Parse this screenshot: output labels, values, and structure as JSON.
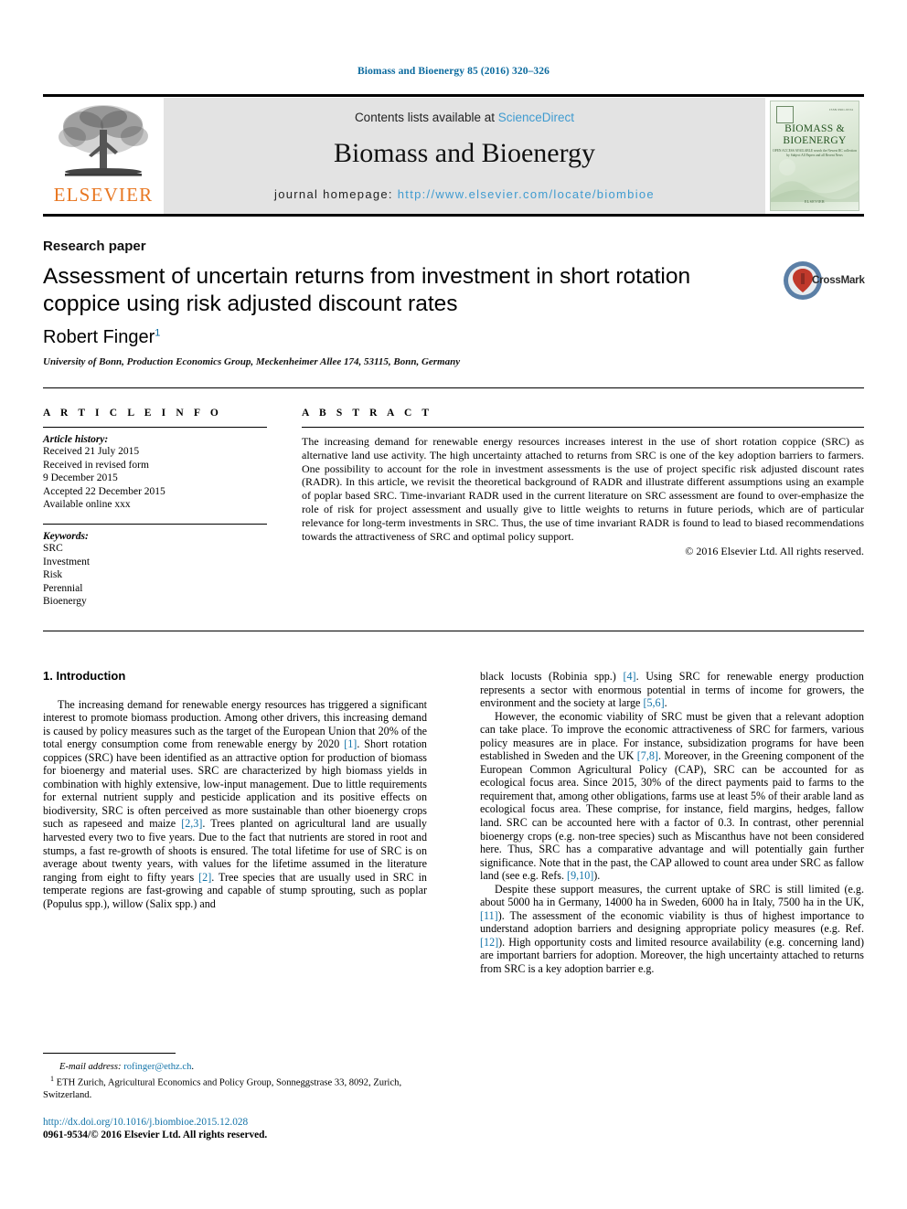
{
  "running_head": "Biomass and Bioenergy 85 (2016) 320–326",
  "masthead": {
    "publisher_name": "ELSEVIER",
    "contents_prefix": "Contents lists available at ",
    "contents_link": "ScienceDirect",
    "journal_name": "Biomass and Bioenergy",
    "homepage_prefix": "journal homepage: ",
    "homepage_url": "http://www.elsevier.com/locate/biombioe",
    "cover": {
      "title_line1": "BIOMASS &",
      "title_line2": "BIOENERGY",
      "subtitle": "OPEN ACCESS AVAILABLE\nsearch the Newest RC collection by Subject\nAll Papers and all Recent News",
      "issn": "ISSN 0961-9534",
      "footer": "ELSEVIER"
    }
  },
  "article": {
    "type": "Research paper",
    "title": "Assessment of uncertain returns from investment in short rotation coppice using risk adjusted discount rates",
    "crossmark_label": "CrossMark",
    "author": "Robert Finger",
    "author_footnote_marker": "1",
    "affiliation": "University of Bonn, Production Economics Group, Meckenheimer Allee 174, 53115, Bonn, Germany"
  },
  "article_info": {
    "heading": "A R T I C L E   I N F O",
    "history_label": "Article history:",
    "history": [
      "Received 21 July 2015",
      "Received in revised form",
      "9 December 2015",
      "Accepted 22 December 2015",
      "Available online xxx"
    ],
    "keywords_label": "Keywords:",
    "keywords": [
      "SRC",
      "Investment",
      "Risk",
      "Perennial",
      "Bioenergy"
    ]
  },
  "abstract": {
    "heading": "A B S T R A C T",
    "text": "The increasing demand for renewable energy resources increases interest in the use of short rotation coppice (SRC) as alternative land use activity. The high uncertainty attached to returns from SRC is one of the key adoption barriers to farmers. One possibility to account for the role in investment assessments is the use of project specific risk adjusted discount rates (RADR). In this article, we revisit the theoretical background of RADR and illustrate different assumptions using an example of poplar based SRC. Time-invariant RADR used in the current literature on SRC assessment are found to over-emphasize the role of risk for project assessment and usually give to little weights to returns in future periods, which are of particular relevance for long-term investments in SRC. Thus, the use of time invariant RADR is found to lead to biased recommendations towards the attractiveness of SRC and optimal policy support.",
    "copyright": "© 2016 Elsevier Ltd. All rights reserved."
  },
  "body": {
    "section_heading": "1. Introduction",
    "left_column": [
      {
        "parts": [
          {
            "t": "The increasing demand for renewable energy resources has triggered a significant interest to promote biomass production. Among other drivers, this increasing demand is caused by policy measures such as the target of the European Union that 20% of the total energy consumption come from renewable energy by 2020 "
          },
          {
            "t": "[1]",
            "ref": true
          },
          {
            "t": ". Short rotation coppices (SRC) have been identified as an attractive option for production of biomass for bioenergy and material uses. SRC are characterized by high biomass yields in combination with highly extensive, low-input management. Due to little requirements for external nutrient supply and pesticide application and its positive effects on biodiversity, SRC is often perceived as more sustainable than other bioenergy crops such as rapeseed and maize "
          },
          {
            "t": "[2,3]",
            "ref": true
          },
          {
            "t": ". Trees planted on agricultural land are usually harvested every two to five years. Due to the fact that nutrients are stored in root and stumps, a fast re-growth of shoots is ensured. The total lifetime for use of SRC is on average about twenty years, with values for the lifetime assumed in the literature ranging from eight to fifty years "
          },
          {
            "t": "[2]",
            "ref": true
          },
          {
            "t": ". Tree species that are usually used in SRC in temperate regions are fast-growing and capable of stump sprouting, such as poplar (Populus spp.), willow (Salix spp.) and"
          }
        ]
      }
    ],
    "right_column": [
      {
        "indent": false,
        "parts": [
          {
            "t": "black locusts (Robinia spp.) "
          },
          {
            "t": "[4]",
            "ref": true
          },
          {
            "t": ". Using SRC for renewable energy production represents a sector with enormous potential in terms of income for growers, the environment and the society at large "
          },
          {
            "t": "[5,6]",
            "ref": true
          },
          {
            "t": "."
          }
        ]
      },
      {
        "indent": true,
        "parts": [
          {
            "t": "However, the economic viability of SRC must be given that a relevant adoption can take place. To improve the economic attractiveness of SRC for farmers, various policy measures are in place. For instance, subsidization programs for have been established in Sweden and the UK "
          },
          {
            "t": "[7,8]",
            "ref": true
          },
          {
            "t": ". Moreover, in the Greening component of the European Common Agricultural Policy (CAP), SRC can be accounted for as ecological focus area. Since 2015, 30% of the direct payments paid to farms to the requirement that, among other obligations, farms use at least 5% of their arable land as ecological focus area. These comprise, for instance, field margins, hedges, fallow land. SRC can be accounted here with a factor of 0.3. In contrast, other perennial bioenergy crops (e.g. non-tree species) such as Miscanthus have not been considered here. Thus, SRC has a comparative advantage and will potentially gain further significance. Note that in the past, the CAP allowed to count area under SRC as fallow land (see e.g. Refs. "
          },
          {
            "t": "[9,10]",
            "ref": true
          },
          {
            "t": ")."
          }
        ]
      },
      {
        "indent": true,
        "parts": [
          {
            "t": "Despite these support measures, the current uptake of SRC is still limited (e.g. about 5000 ha in Germany, 14000 ha in Sweden, 6000 ha in Italy, 7500 ha in the UK, "
          },
          {
            "t": "[11]",
            "ref": true
          },
          {
            "t": "). The assessment of the economic viability is thus of highest importance to understand adoption barriers and designing appropriate policy measures (e.g. Ref. "
          },
          {
            "t": "[12]",
            "ref": true
          },
          {
            "t": "). High opportunity costs and limited resource availability (e.g. concerning land) are important barriers for adoption. Moreover, the high uncertainty attached to returns from SRC is a key adoption barrier e.g."
          }
        ]
      }
    ]
  },
  "footnotes": {
    "email_label": "E-mail address:",
    "email": "rofinger@ethz.ch",
    "email_suffix": ".",
    "marker": "1",
    "present_address": "ETH Zurich, Agricultural Economics and Policy Group, Sonneggstrase 33, 8092, Zurich, Switzerland."
  },
  "doi_block": {
    "doi": "http://dx.doi.org/10.1016/j.biombioe.2015.12.028",
    "issn_line": "0961-9534/© 2016 Elsevier Ltd. All rights reserved."
  }
}
